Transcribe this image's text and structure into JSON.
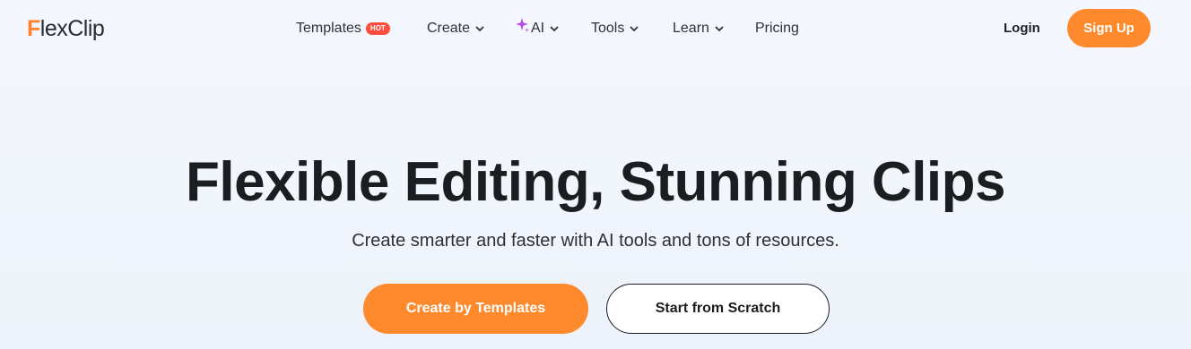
{
  "brand": {
    "logo_first": "F",
    "logo_rest": "lexClip"
  },
  "nav": {
    "templates": "Templates",
    "hot_badge": "HOT",
    "create": "Create",
    "ai": "AI",
    "tools": "Tools",
    "learn": "Learn",
    "pricing": "Pricing"
  },
  "auth": {
    "login": "Login",
    "signup": "Sign Up"
  },
  "hero": {
    "title": "Flexible Editing, Stunning Clips",
    "subtitle": "Create smarter and faster with AI tools and tons of resources.",
    "primary_cta": "Create by Templates",
    "secondary_cta": "Start from Scratch"
  },
  "colors": {
    "accent": "#ff8a2e",
    "hot": "#ff4d3d",
    "ai_spark": "#b04fe8"
  },
  "icons": {
    "chevron": "chevron-down-icon",
    "ai": "sparkle-icon"
  }
}
